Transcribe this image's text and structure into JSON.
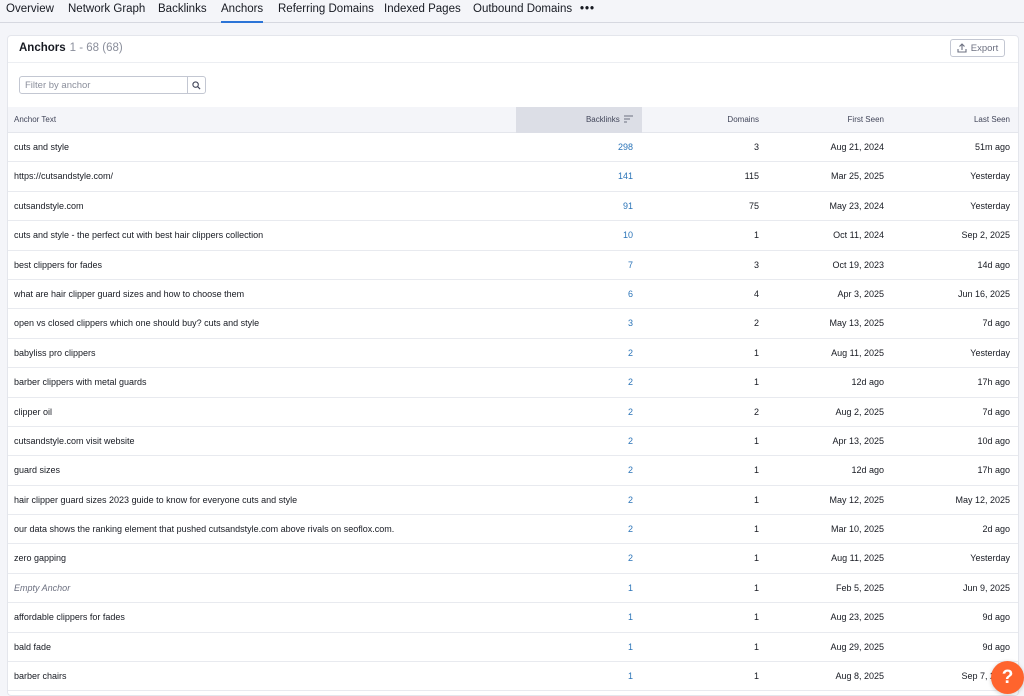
{
  "tabs": [
    {
      "label": "Overview",
      "active": false
    },
    {
      "label": "Network Graph",
      "active": false
    },
    {
      "label": "Backlinks",
      "active": false
    },
    {
      "label": "Anchors",
      "active": true
    },
    {
      "label": "Referring Domains",
      "active": false
    },
    {
      "label": "Indexed Pages",
      "active": false
    },
    {
      "label": "Outbound Domains",
      "active": false
    }
  ],
  "more_tabs_label": "•••",
  "panel": {
    "title": "Anchors",
    "count": "1 - 68 (68)",
    "export_label": "Export"
  },
  "filter": {
    "placeholder": "Filter by anchor",
    "value": ""
  },
  "table": {
    "columns": {
      "anchor": "Anchor Text",
      "backlinks": "Backlinks",
      "domains": "Domains",
      "first_seen": "First Seen",
      "last_seen": "Last Seen"
    },
    "sorted_column": "backlinks",
    "rows": [
      {
        "anchor": "cuts and style",
        "backlinks": "298",
        "domains": "3",
        "first_seen": "Aug 21, 2024",
        "last_seen": "51m ago"
      },
      {
        "anchor": "https://cutsandstyle.com/",
        "backlinks": "141",
        "domains": "115",
        "first_seen": "Mar 25, 2025",
        "last_seen": "Yesterday"
      },
      {
        "anchor": "cutsandstyle.com",
        "backlinks": "91",
        "domains": "75",
        "first_seen": "May 23, 2024",
        "last_seen": "Yesterday"
      },
      {
        "anchor": "cuts and style - the perfect cut with best hair clippers collection",
        "backlinks": "10",
        "domains": "1",
        "first_seen": "Oct 11, 2024",
        "last_seen": "Sep 2, 2025"
      },
      {
        "anchor": "best clippers for fades",
        "backlinks": "7",
        "domains": "3",
        "first_seen": "Oct 19, 2023",
        "last_seen": "14d ago"
      },
      {
        "anchor": "what are hair clipper guard sizes and how to choose them",
        "backlinks": "6",
        "domains": "4",
        "first_seen": "Apr 3, 2025",
        "last_seen": "Jun 16, 2025"
      },
      {
        "anchor": "open vs closed clippers which one should buy? cuts and style",
        "backlinks": "3",
        "domains": "2",
        "first_seen": "May 13, 2025",
        "last_seen": "7d ago"
      },
      {
        "anchor": "babyliss pro clippers",
        "backlinks": "2",
        "domains": "1",
        "first_seen": "Aug 11, 2025",
        "last_seen": "Yesterday"
      },
      {
        "anchor": "barber clippers with metal guards",
        "backlinks": "2",
        "domains": "1",
        "first_seen": "12d ago",
        "last_seen": "17h ago"
      },
      {
        "anchor": "clipper oil",
        "backlinks": "2",
        "domains": "2",
        "first_seen": "Aug 2, 2025",
        "last_seen": "7d ago"
      },
      {
        "anchor": "cutsandstyle.com visit website",
        "backlinks": "2",
        "domains": "1",
        "first_seen": "Apr 13, 2025",
        "last_seen": "10d ago"
      },
      {
        "anchor": "guard sizes",
        "backlinks": "2",
        "domains": "1",
        "first_seen": "12d ago",
        "last_seen": "17h ago"
      },
      {
        "anchor": "hair clipper guard sizes 2023 guide to know for everyone cuts and style",
        "backlinks": "2",
        "domains": "1",
        "first_seen": "May 12, 2025",
        "last_seen": "May 12, 2025"
      },
      {
        "anchor": "our data shows the ranking element that pushed cutsandstyle.com above rivals on seoflox.com.",
        "backlinks": "2",
        "domains": "1",
        "first_seen": "Mar 10, 2025",
        "last_seen": "2d ago"
      },
      {
        "anchor": "zero gapping",
        "backlinks": "2",
        "domains": "1",
        "first_seen": "Aug 11, 2025",
        "last_seen": "Yesterday"
      },
      {
        "anchor": "Empty Anchor",
        "empty": true,
        "backlinks": "1",
        "domains": "1",
        "first_seen": "Feb 5, 2025",
        "last_seen": "Jun 9, 2025"
      },
      {
        "anchor": "affordable clippers for fades",
        "backlinks": "1",
        "domains": "1",
        "first_seen": "Aug 23, 2025",
        "last_seen": "9d ago"
      },
      {
        "anchor": "bald fade",
        "backlinks": "1",
        "domains": "1",
        "first_seen": "Aug 29, 2025",
        "last_seen": "9d ago"
      },
      {
        "anchor": "barber chairs",
        "backlinks": "1",
        "domains": "1",
        "first_seen": "Aug 8, 2025",
        "last_seen": "Sep 7, 2025"
      }
    ]
  },
  "help_label": "?",
  "colors": {
    "accent": "#2b74d7",
    "link": "#2b74b8",
    "help": "#ff642d"
  },
  "icons": {
    "export": "upload-icon",
    "search": "search-icon",
    "sort": "sort-descending-icon",
    "help": "question-icon"
  }
}
